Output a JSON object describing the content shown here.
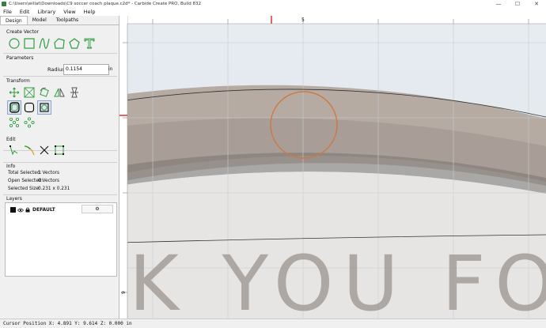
{
  "window": {
    "title": "C:\\Users\\willat\\Downloads\\C9 soccer coach plaque.c2d* - Carbide Create PRO, Build 832",
    "min_glyph": "—",
    "max_glyph": "☐",
    "close_glyph": "✕"
  },
  "menu": {
    "file": "File",
    "edit": "Edit",
    "library": "Library",
    "view": "View",
    "help": "Help"
  },
  "tabs": {
    "design": "Design",
    "model": "Model",
    "toolpaths": "Toolpaths"
  },
  "sections": {
    "create_vector": "Create Vector",
    "parameters": "Parameters",
    "transform": "Transform",
    "edit": "Edit",
    "info": "Info",
    "layers": "Layers"
  },
  "parameters": {
    "radius_label": "Radius",
    "radius_value": "0.1154",
    "unit": "in"
  },
  "info": {
    "total_selected_label": "Total Selected:",
    "total_selected_value": "1 Vectors",
    "open_selected_label": "Open Selected:",
    "open_selected_value": "0 Vectors",
    "selected_size_label": "Selected Size:",
    "selected_size_value": "0.231 x 0.231"
  },
  "layers": {
    "default_name": "DEFAULT",
    "gear": "⚙"
  },
  "ruler": {
    "top_label": "5",
    "left_label": "9"
  },
  "canvas_text": {
    "plaque_text": "K YOU FO"
  },
  "status": {
    "cursor": "Cursor Position X: 4.891 Y: 9.614 Z: 0.000 in"
  },
  "colors": {
    "accent_green": "#2e9e3e",
    "selection_orange": "#d07840",
    "ruler_red": "#e02020"
  }
}
